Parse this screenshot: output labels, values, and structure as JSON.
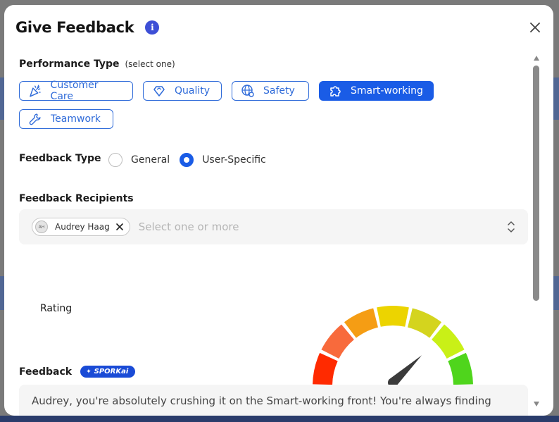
{
  "modal": {
    "title": "Give Feedback",
    "info_icon": "info-icon",
    "close_icon": "close-icon"
  },
  "performance_type": {
    "label": "Performance Type",
    "hint": "(select one)",
    "options": [
      {
        "label": "Customer Care",
        "icon": "party-popper-icon",
        "selected": false
      },
      {
        "label": "Quality",
        "icon": "diamond-icon",
        "selected": false
      },
      {
        "label": "Safety",
        "icon": "globe-gear-icon",
        "selected": false
      },
      {
        "label": "Smart-working",
        "icon": "puzzle-icon",
        "selected": true
      },
      {
        "label": "Teamwork",
        "icon": "wrench-icon",
        "selected": false
      }
    ]
  },
  "feedback_type": {
    "label": "Feedback Type",
    "options": [
      {
        "label": "General",
        "selected": false
      },
      {
        "label": "User-Specific",
        "selected": true
      }
    ]
  },
  "recipients": {
    "label": "Feedback Recipients",
    "selected": [
      {
        "initials": "AH",
        "name": "Audrey Haag"
      }
    ],
    "placeholder": "Select one or more"
  },
  "rating": {
    "label": "Rating",
    "segments": [
      "#ff2a00",
      "#f86a3c",
      "#f59d14",
      "#ecd400",
      "#d4d41e",
      "#c9f017",
      "#4fd51c"
    ],
    "needle_fraction": 0.74
  },
  "feedback": {
    "label": "Feedback",
    "ai_badge": "SPORKai",
    "text": "Audrey, you're absolutely crushing it on the Smart-working front! You're always finding"
  },
  "colors": {
    "accent": "#1a5ce6",
    "chip_border": "#2f6bd9"
  }
}
